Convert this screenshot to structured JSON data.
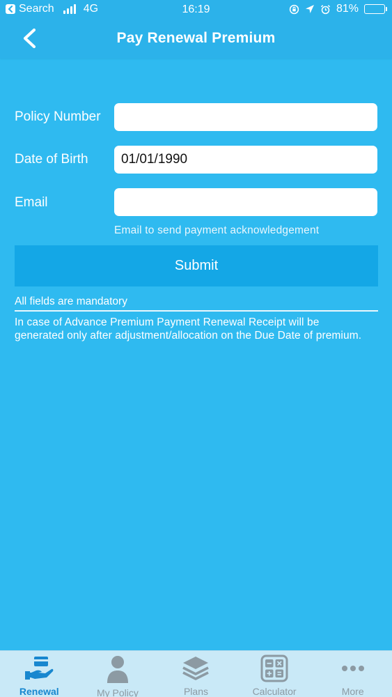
{
  "status_bar": {
    "back_app": "Search",
    "network": "4G",
    "time": "16:19",
    "battery": "81%",
    "battery_level": 0.81
  },
  "nav": {
    "title": "Pay Renewal Premium",
    "back_icon": "chevron-left-icon"
  },
  "form": {
    "policy_number": {
      "label": "Policy Number",
      "value": "",
      "placeholder": ""
    },
    "dob": {
      "label": "Date of Birth",
      "value": "01/01/1990",
      "placeholder": ""
    },
    "email": {
      "label": "Email",
      "value": "",
      "placeholder": "",
      "hint": "Email to send payment acknowledgement"
    },
    "submit_label": "Submit",
    "mandatory_text": "All fields are mandatory",
    "note": "In case of Advance Premium Payment Renewal Receipt will be generated only after adjustment/allocation on the Due Date of premium."
  },
  "tabs": [
    {
      "label": "Renewal",
      "icon": "renewal-hand-card-icon",
      "active": true
    },
    {
      "label": "My Policy",
      "icon": "person-icon",
      "active": false
    },
    {
      "label": "Plans",
      "icon": "layers-icon",
      "active": false
    },
    {
      "label": "Calculator",
      "icon": "calculator-icon",
      "active": false
    },
    {
      "label": "More",
      "icon": "more-dots-icon",
      "active": false
    }
  ],
  "colors": {
    "background": "#2fbaf0",
    "header": "#2cb2ea",
    "submit": "#14a7e6",
    "tab_bar": "#c9e9f7",
    "tab_active": "#1887cf",
    "tab_inactive": "#8c9aa3"
  }
}
